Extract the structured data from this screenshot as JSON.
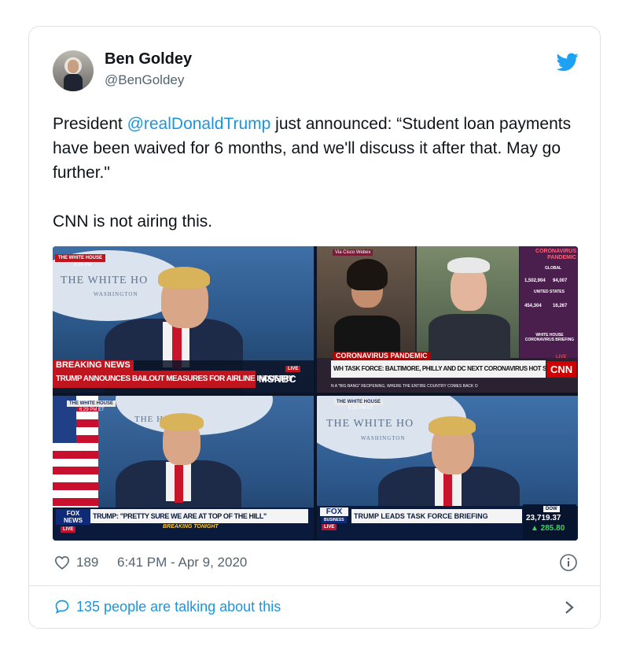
{
  "user": {
    "display_name": "Ben Goldey",
    "handle": "@BenGoldey"
  },
  "tweet": {
    "text_before": "President ",
    "mention": "@realDonaldTrump",
    "text_after": " just announced: “Student loan payments have been waived for 6 months, and we'll discuss it after that. May go further.\"",
    "paragraph2": "CNN is not airing this."
  },
  "media": {
    "panel1": {
      "tag": "THE WHITE HOUSE",
      "tag_time": "6:29 PM",
      "seal_text": "THE WHITE HO",
      "seal_subtext": "WASHINGTON",
      "breaking": "BREAKING NEWS",
      "headline": "TRUMP ANNOUNCES BAILOUT MEASURES FOR AIRLINE INDUSTRY",
      "live": "LIVE",
      "network": "MSNBC"
    },
    "panel2": {
      "via": "Via Cisco Webex",
      "topic": "CORONAVIRUS PANDEMIC",
      "headline": "WH TASK FORCE: BALTIMORE, PHILLY AND DC NEXT CORONAVIRUS HOT SPOTS",
      "ticker": "N A \"BIG BANG\" REOPENING, WHERE THE ENTIRE COUNTRY COMES BACK O",
      "sidebar_title": "CORONAVIRUS PANDEMIC",
      "sidebar_global": "GLOBAL",
      "sidebar_global_cases": "1,502,904",
      "sidebar_global_deaths": "94,007",
      "sidebar_us": "UNITED STATES",
      "sidebar_us_cases": "454,304",
      "sidebar_us_deaths": "16,267",
      "sidebar_note": "WHITE HOUSE CORONAVIRUS BRIEFING",
      "live": "LIVE",
      "network": "CNN"
    },
    "panel3": {
      "tag": "THE WHITE HOUSE",
      "tag_time": "6:29 PM ET",
      "seal_text": "THE     HOUSE",
      "network": "FOX NEWS",
      "live": "LIVE",
      "headline": "TRUMP: \"PRETTY SURE WE ARE AT TOP OF THE HILL\"",
      "subheadline": "BREAKING TONIGHT"
    },
    "panel4": {
      "tag": "THE WHITE HOUSE",
      "tag_time": "6:29 PM ET",
      "seal_text": "THE WHITE HO",
      "seal_subtext": "WASHINGTON",
      "network": "FOX",
      "network_sub": "BUSINESS",
      "live": "LIVE",
      "headline": "TRUMP LEADS TASK FORCE BRIEFING",
      "dow_label": "DOW",
      "dow_value": "23,719.37",
      "dow_change": "▲ 285.80"
    }
  },
  "footer": {
    "like_count": "189",
    "timestamp": "6:41 PM - Apr 9, 2020",
    "talking": "135 people are talking about this"
  },
  "colors": {
    "link": "#1b95e0",
    "twitter_blue": "#1da1f2",
    "secondary_text": "#536471",
    "msnbc_red": "#c0151f",
    "cnn_red": "#cc0000",
    "fox_red": "#c8102e"
  }
}
